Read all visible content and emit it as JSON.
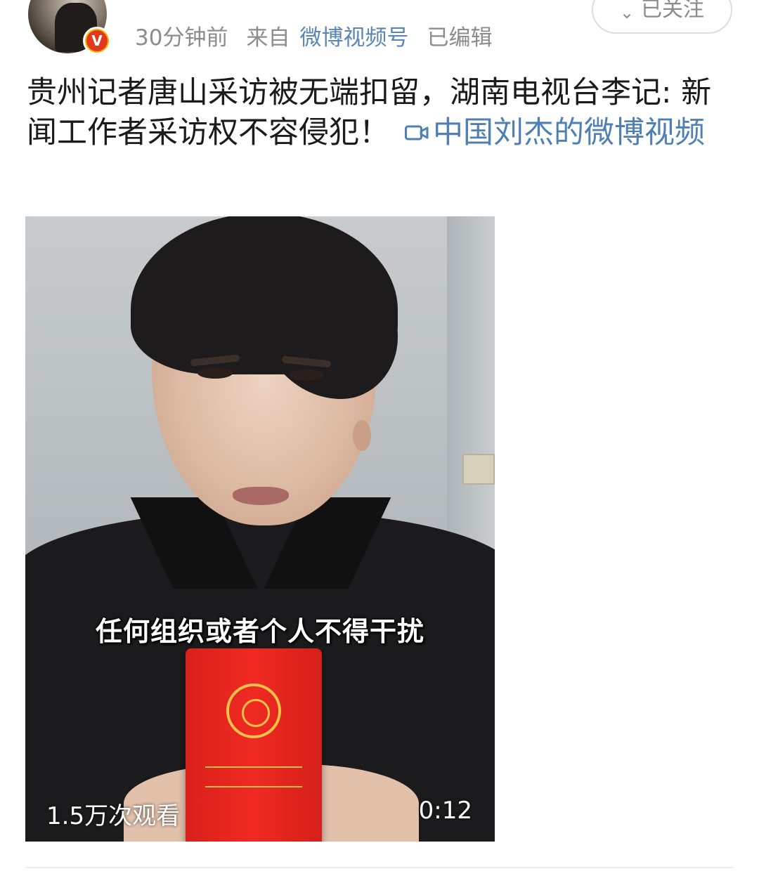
{
  "header": {
    "author_name_partial": "",
    "verified_badge": "V",
    "timestamp": "30分钟前",
    "source_prefix": "来自",
    "source": "微博视频号",
    "edited": "已编辑",
    "follow_button": "已关注",
    "follow_icon": "chevron-down-icon"
  },
  "post": {
    "text": "贵州记者唐山采访被无端扣留，湖南电视台李记: 新闻工作者采访权不容侵犯！",
    "link_icon": "video-camera-icon",
    "link_text": "中国刘杰的微博视频"
  },
  "video": {
    "caption": "任何组织或者个人不得干扰",
    "views": "1.5万次观看",
    "duration": "0:12"
  },
  "colors": {
    "link": "#4f7fb3",
    "meta": "#8c8c8c",
    "badge": "#f7b500"
  }
}
